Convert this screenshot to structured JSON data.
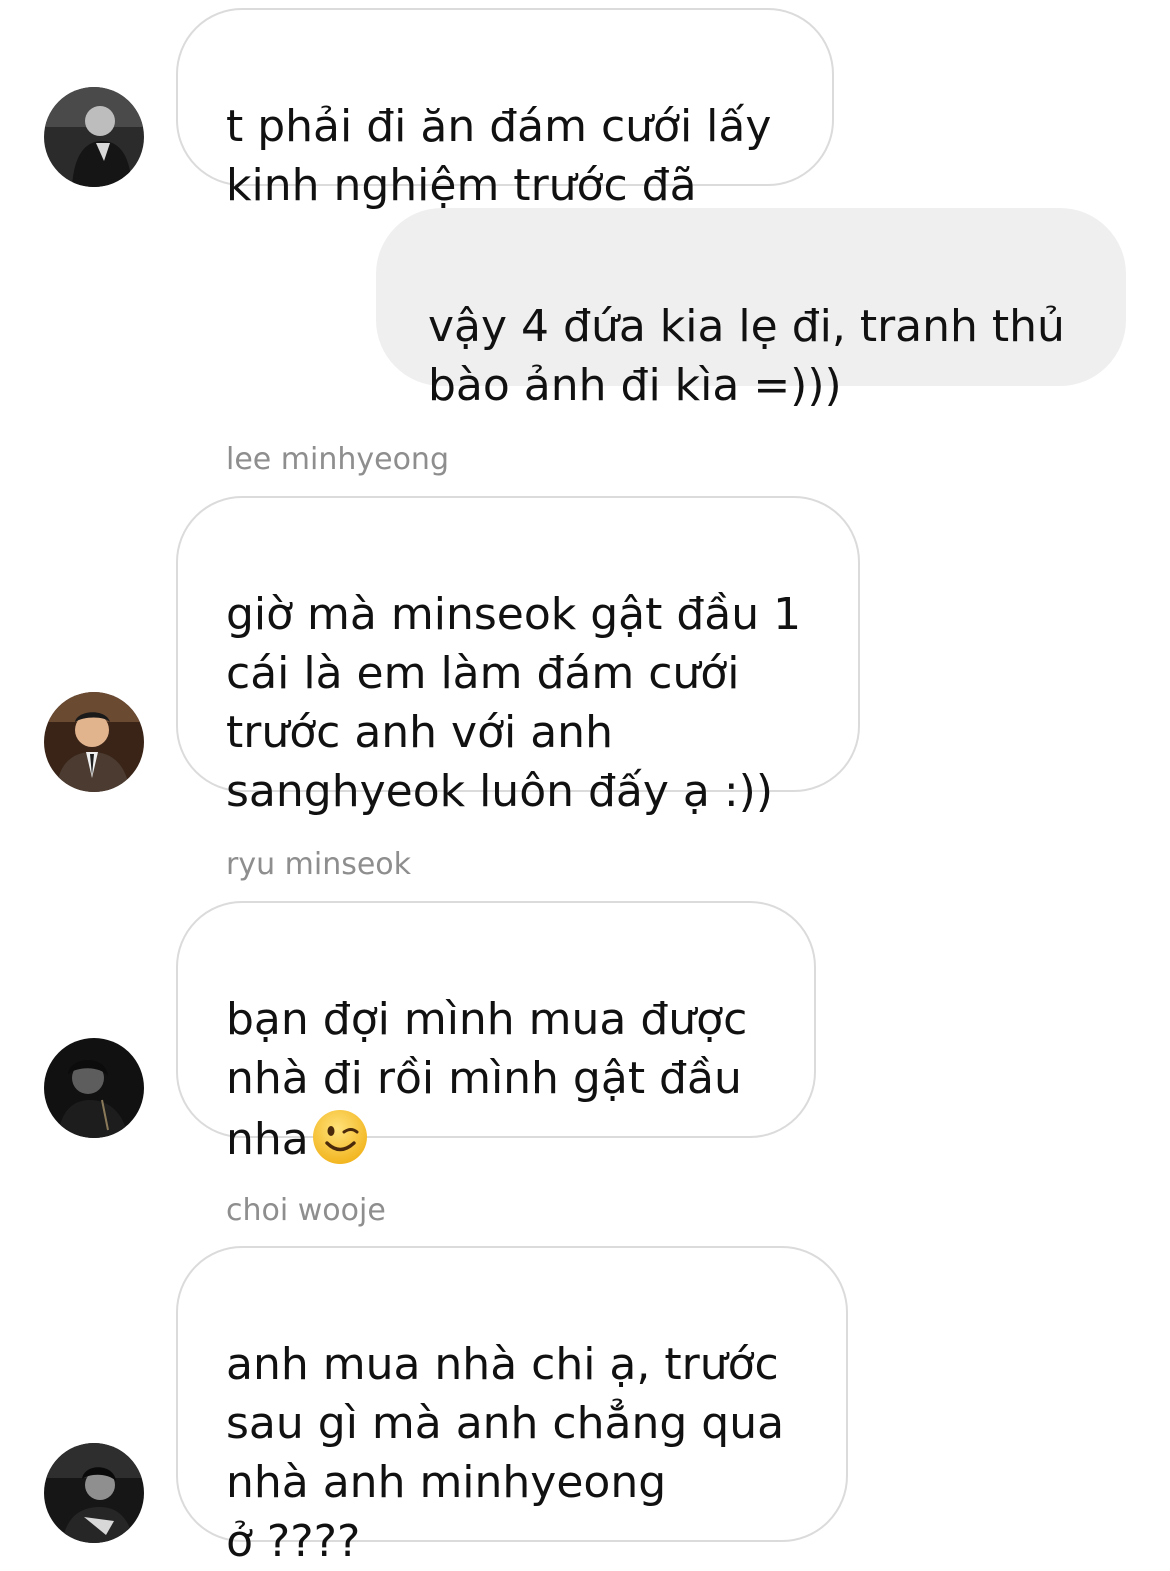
{
  "thread": {
    "messages": [
      {
        "direction": "incoming",
        "sender": "",
        "text": "t phải đi ăn đám cưới lấy\nkinh nghiệm trước đã",
        "avatar_icon": "user-avatar-icon"
      },
      {
        "direction": "outgoing",
        "sender": "",
        "text": "vậy 4 đứa kia lẹ đi, tranh thủ\nbào ảnh đi kìa =)))"
      },
      {
        "direction": "incoming",
        "sender": "lee minhyeong",
        "text": "giờ mà minseok gật đầu 1\ncái là em làm đám cưới\ntrước anh với anh\nsanghyeok luôn đấy ạ :))",
        "avatar_icon": "user-avatar-icon"
      },
      {
        "direction": "incoming",
        "sender": "ryu minseok",
        "text": "bạn đợi mình mua được\nnhà đi rồi mình gật đầu\nnha",
        "emoji": "winking-face-emoji",
        "avatar_icon": "user-avatar-icon"
      },
      {
        "direction": "incoming",
        "sender": "choi wooje",
        "text": "anh mua nhà chi ạ, trước\nsau gì mà anh chẳng qua\nnhà anh minhyeong\nở ????",
        "avatar_icon": "user-avatar-icon"
      }
    ]
  },
  "colors": {
    "incoming_bubble_bg": "#ffffff",
    "incoming_bubble_border": "#dbdbdb",
    "outgoing_bubble_bg": "#efefef",
    "sender_name": "#8e8e8e",
    "message_text": "#111111"
  }
}
